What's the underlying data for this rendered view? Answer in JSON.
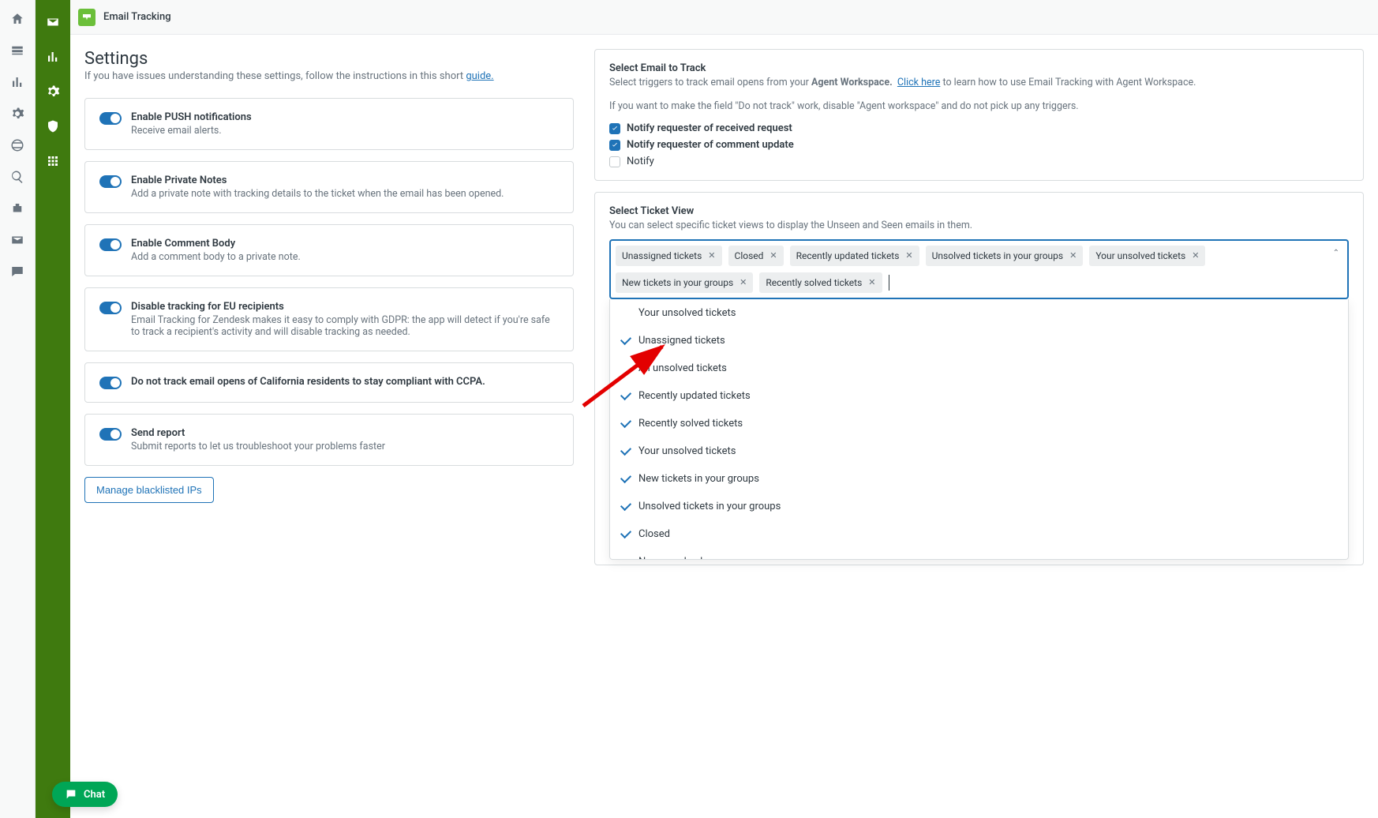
{
  "app": {
    "title": "Email Tracking"
  },
  "page": {
    "heading": "Settings",
    "subtext_prefix": "If you have issues understanding these settings, follow the instructions in this short ",
    "subtext_link": "guide."
  },
  "toggles": {
    "push": {
      "label": "Enable PUSH notifications",
      "desc": "Receive email alerts."
    },
    "private_notes": {
      "label": "Enable Private Notes",
      "desc": "Add a private note with tracking details to the ticket when the email has been opened."
    },
    "comment_body": {
      "label": "Enable Comment Body",
      "desc": "Add a comment body to a private note."
    },
    "eu_disable": {
      "label": "Disable tracking for EU recipients",
      "desc": "Email Tracking for Zendesk makes it easy to comply with GDPR: the app will detect if you're safe to track a recipient's activity and will disable tracking as needed."
    },
    "ccpa": {
      "label": "Do not track email opens of California residents to stay compliant with CCPA."
    },
    "send_report": {
      "label": "Send report",
      "desc": "Submit reports to let us troubleshoot your problems faster"
    }
  },
  "buttons": {
    "manage_blacklist": "Manage blacklisted IPs"
  },
  "email_track": {
    "title": "Select Email to Track",
    "desc_prefix": "Select triggers to track email opens from your ",
    "desc_bold": "Agent Workspace.",
    "desc_link": "Click here",
    "desc_suffix": " to learn how to use Email Tracking with Agent Workspace.",
    "warn": "If you want to make the field \"Do not track\" work, disable \"Agent workspace\" and do not pick up any triggers.",
    "checks": [
      {
        "label": "Notify requester of received request",
        "checked": true
      },
      {
        "label": "Notify requester of comment update",
        "checked": true
      },
      {
        "label": "Notify",
        "checked": false
      }
    ]
  },
  "ticket_view": {
    "title": "Select Ticket View",
    "desc": "You can select specific ticket views to display the Unseen and Seen emails in them.",
    "selected": [
      "Unassigned tickets",
      "Closed",
      "Recently updated tickets",
      "Unsolved tickets in your groups",
      "Your unsolved tickets",
      "New tickets in your groups",
      "Recently solved tickets"
    ],
    "options": [
      {
        "label": "Your unsolved tickets",
        "selected": false
      },
      {
        "label": "Unassigned tickets",
        "selected": true
      },
      {
        "label": "All unsolved tickets",
        "selected": false
      },
      {
        "label": "Recently updated tickets",
        "selected": true
      },
      {
        "label": "Recently solved tickets",
        "selected": true
      },
      {
        "label": "Your unsolved tickets",
        "selected": true
      },
      {
        "label": "New tickets in your groups",
        "selected": true
      },
      {
        "label": "Unsolved tickets in your groups",
        "selected": true
      },
      {
        "label": "Closed",
        "selected": true
      },
      {
        "label": "New unsolved",
        "selected": false
      }
    ]
  },
  "chat": {
    "label": "Chat"
  }
}
